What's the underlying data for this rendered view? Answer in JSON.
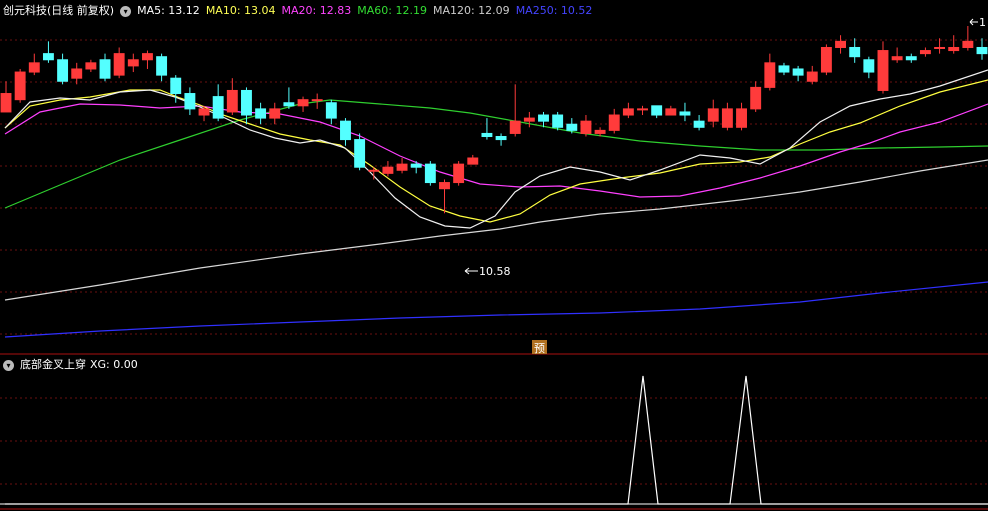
{
  "main_header": {
    "title": "创元科技(日线 前复权)",
    "ma": [
      {
        "label": "MA5: 13.12",
        "color": "#ffffff"
      },
      {
        "label": "MA10: 13.04",
        "color": "#ffff55"
      },
      {
        "label": "MA20: 12.83",
        "color": "#ff44ff"
      },
      {
        "label": "MA60: 12.19",
        "color": "#33dd33"
      },
      {
        "label": "MA120: 12.09",
        "color": "#cccccc"
      },
      {
        "label": "MA250: 10.52",
        "color": "#4444ff"
      }
    ]
  },
  "low_label": "10.58",
  "high_label": "1",
  "pre_marker": "预",
  "sub_header": {
    "title": "底部金叉上穿",
    "value": "XG: 0.00"
  },
  "chart_data": {
    "type": "candlestick",
    "ylim": [
      10.0,
      14.3
    ],
    "candles": [
      [
        12.9,
        13.2,
        13.4,
        12.9
      ],
      [
        13.1,
        13.55,
        13.6,
        13.05
      ],
      [
        13.55,
        13.7,
        13.85,
        13.5
      ],
      [
        13.85,
        13.75,
        14.05,
        13.7
      ],
      [
        13.75,
        13.4,
        13.85,
        13.35
      ],
      [
        13.45,
        13.6,
        13.7,
        13.35
      ],
      [
        13.6,
        13.7,
        13.75,
        13.55
      ],
      [
        13.75,
        13.45,
        13.85,
        13.4
      ],
      [
        13.5,
        13.85,
        13.95,
        13.45
      ],
      [
        13.65,
        13.75,
        13.85,
        13.55
      ],
      [
        13.75,
        13.85,
        13.9,
        13.6
      ],
      [
        13.8,
        13.5,
        13.85,
        13.4
      ],
      [
        13.45,
        13.2,
        13.5,
        13.05
      ],
      [
        13.2,
        12.95,
        13.3,
        12.85
      ],
      [
        12.85,
        12.95,
        13.0,
        12.75
      ],
      [
        13.15,
        12.8,
        13.35,
        12.75
      ],
      [
        12.9,
        13.25,
        13.45,
        12.85
      ],
      [
        13.25,
        12.85,
        13.3,
        12.7
      ],
      [
        12.95,
        12.8,
        13.05,
        12.7
      ],
      [
        12.8,
        12.95,
        13.05,
        12.7
      ],
      [
        13.05,
        13.0,
        13.3,
        12.95
      ],
      [
        13.0,
        13.1,
        13.15,
        12.9
      ],
      [
        13.1,
        13.1,
        13.2,
        12.95
      ],
      [
        13.05,
        12.8,
        13.1,
        12.7
      ],
      [
        12.75,
        12.45,
        12.8,
        12.35
      ],
      [
        12.45,
        12.0,
        12.55,
        11.95
      ],
      [
        11.95,
        11.95,
        12.0,
        11.8
      ],
      [
        11.9,
        12.0,
        12.1,
        11.85
      ],
      [
        11.95,
        12.05,
        12.15,
        11.9
      ],
      [
        12.05,
        12.0,
        12.1,
        11.9
      ],
      [
        12.05,
        11.75,
        12.1,
        11.7
      ],
      [
        11.65,
        11.75,
        11.8,
        11.25
      ],
      [
        11.75,
        12.05,
        12.1,
        11.7
      ],
      [
        12.05,
        12.15,
        12.2,
        12.05
      ],
      [
        12.55,
        12.5,
        12.8,
        12.45
      ],
      [
        12.5,
        12.45,
        12.55,
        12.35
      ],
      [
        12.55,
        12.75,
        13.35,
        12.5
      ],
      [
        12.75,
        12.8,
        12.9,
        12.65
      ],
      [
        12.85,
        12.75,
        12.9,
        12.65
      ],
      [
        12.85,
        12.65,
        12.9,
        12.6
      ],
      [
        12.7,
        12.6,
        12.8,
        12.55
      ],
      [
        12.55,
        12.75,
        12.85,
        12.5
      ],
      [
        12.55,
        12.6,
        12.65,
        12.5
      ],
      [
        12.6,
        12.85,
        12.95,
        12.55
      ],
      [
        12.85,
        12.95,
        13.05,
        12.8
      ],
      [
        12.95,
        12.95,
        13.0,
        12.85
      ],
      [
        13.0,
        12.85,
        13.0,
        12.8
      ],
      [
        12.85,
        12.95,
        13.0,
        12.85
      ],
      [
        12.9,
        12.85,
        13.05,
        12.75
      ],
      [
        12.75,
        12.65,
        12.85,
        12.6
      ],
      [
        12.75,
        12.95,
        13.1,
        12.65
      ],
      [
        12.65,
        12.95,
        13.05,
        12.6
      ],
      [
        12.65,
        12.95,
        13.05,
        12.6
      ],
      [
        12.95,
        13.3,
        13.4,
        12.9
      ],
      [
        13.3,
        13.7,
        13.85,
        13.25
      ],
      [
        13.65,
        13.55,
        13.7,
        13.5
      ],
      [
        13.6,
        13.5,
        13.65,
        13.4
      ],
      [
        13.4,
        13.55,
        13.65,
        13.35
      ],
      [
        13.55,
        13.95,
        14.0,
        13.5
      ],
      [
        13.95,
        14.05,
        14.15,
        13.85
      ],
      [
        13.95,
        13.8,
        14.1,
        13.7
      ],
      [
        13.75,
        13.55,
        13.8,
        13.45
      ],
      [
        13.25,
        13.9,
        14.05,
        13.2
      ],
      [
        13.75,
        13.8,
        13.95,
        13.7
      ],
      [
        13.8,
        13.75,
        13.85,
        13.7
      ],
      [
        13.85,
        13.9,
        13.95,
        13.8
      ],
      [
        13.95,
        13.95,
        14.1,
        13.85
      ],
      [
        13.9,
        13.95,
        14.15,
        13.85
      ],
      [
        13.95,
        14.05,
        14.3,
        13.9
      ],
      [
        13.95,
        13.85,
        14.1,
        13.75
      ]
    ],
    "xg_signal_positions": [
      0.645,
      0.745
    ]
  }
}
